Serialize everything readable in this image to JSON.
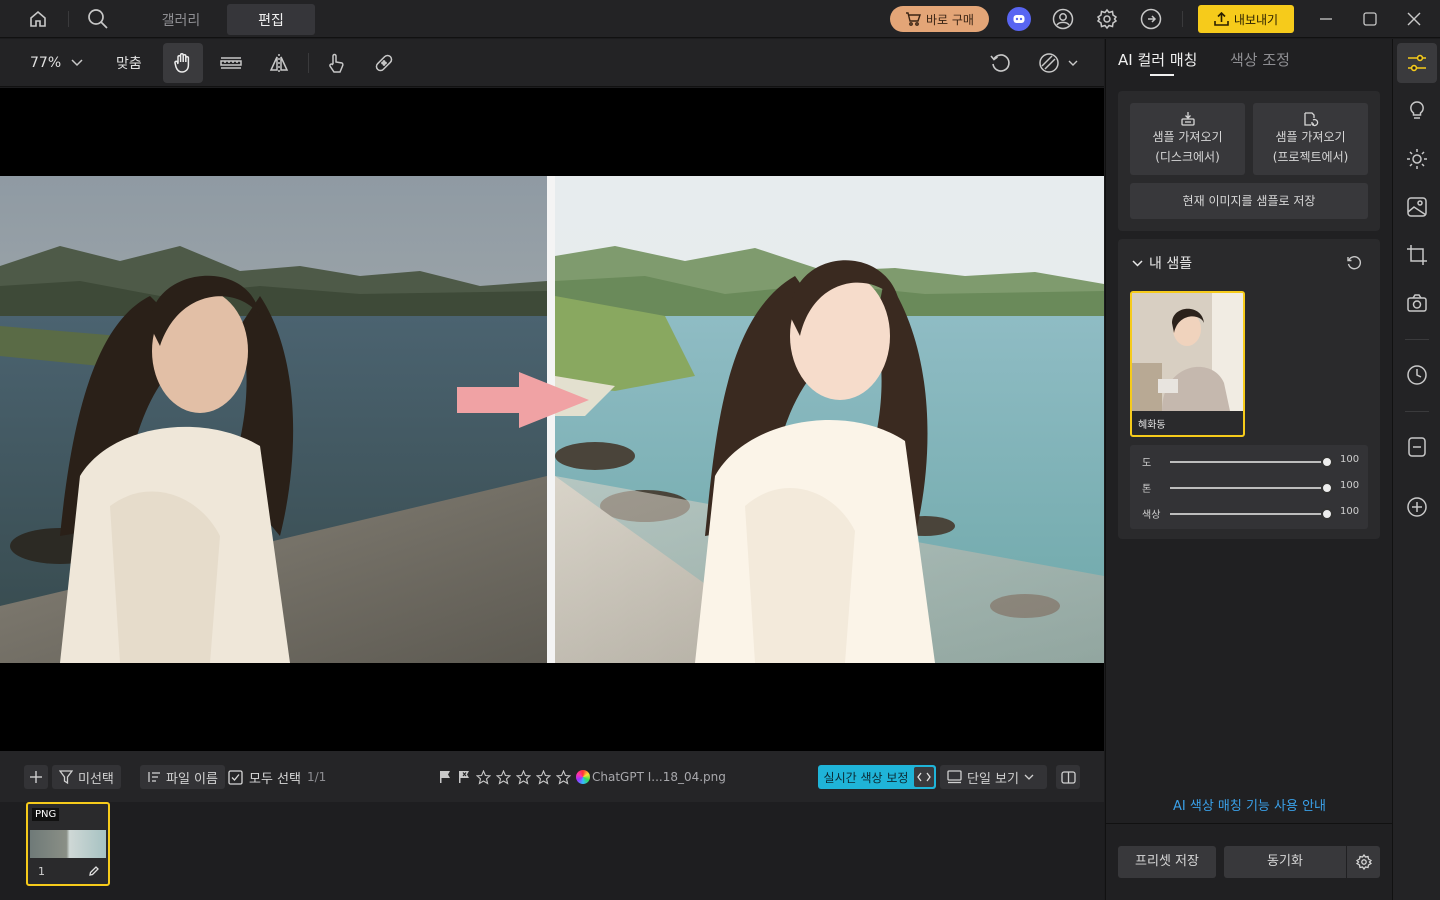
{
  "topbar": {
    "tabs": [
      "갤러리",
      "편집"
    ],
    "active_tab": "편집",
    "buy_label": "바로 구매",
    "export_label": "내보내기"
  },
  "toolbar": {
    "zoom": "77%",
    "fit_label": "맞춤"
  },
  "right_panel": {
    "tabs": [
      "AI 컬러 매칭",
      "색상 조정"
    ],
    "import_disk": [
      "샘플 가져오기",
      "(디스크에서)"
    ],
    "import_project": [
      "샘플 가져오기",
      "(프로젝트에서)"
    ],
    "save_sample": "현재 이미지를 샘플로 저장",
    "my_samples_title": "내 샘플",
    "sample_name": "혜화동",
    "sliders": [
      {
        "label": "도",
        "value": 100
      },
      {
        "label": "톤",
        "value": 100
      },
      {
        "label": "색상",
        "value": 100
      }
    ],
    "guide_link": "AI 색상 매칭 기능 사용 안내",
    "preset_save": "프리셋 저장",
    "sync": "동기화"
  },
  "bottom_bar": {
    "filter_label": "미선택",
    "sort_label": "파일 이름",
    "select_all_label": "모두 선택",
    "select_count": "1/1",
    "file_name": "ChatGPT I...18_04.png",
    "realtime_label": "실시간 색상 보정",
    "view_label": "단일 보기"
  },
  "filmstrip": {
    "items": [
      {
        "format": "PNG",
        "index": "1"
      }
    ]
  },
  "colors": {
    "accent_yellow": "#f6cb1b",
    "buy_orange": "#e3a577",
    "realtime_cyan": "#1fb4d8",
    "link_blue": "#3aa0e8"
  }
}
